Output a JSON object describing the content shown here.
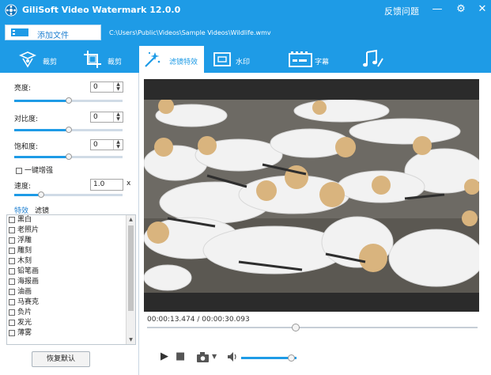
{
  "app": {
    "title": "GiliSoft Video Watermark 12.0.0",
    "feedback_label": "反馈问题"
  },
  "file": {
    "add_label": "添加文件",
    "path": "C:\\Users\\Public\\Videos\\Sample Videos\\Wildlife.wmv"
  },
  "tabs": [
    {
      "label": "裁剪",
      "icon": "crop-tool-icon"
    },
    {
      "label": "裁剪",
      "icon": "crop-frame-icon"
    },
    {
      "label": "滤镜特效",
      "icon": "filter-effects-icon"
    },
    {
      "label": "水印",
      "icon": "watermark-icon"
    },
    {
      "label": "字幕",
      "icon": "subtitle-icon"
    },
    {
      "label": "",
      "icon": "music-icon"
    }
  ],
  "adjust": {
    "brightness": {
      "label": "亮度:",
      "value": "0",
      "level": 0.5
    },
    "contrast": {
      "label": "对比度:",
      "value": "0",
      "level": 0.5
    },
    "saturation": {
      "label": "饱和度:",
      "value": "0",
      "level": 0.5
    },
    "enhance_label": "一键增强",
    "speed": {
      "label": "速度:",
      "value": "1.0",
      "unit": "x",
      "level": 0.25
    }
  },
  "effect_tabs": [
    "特效",
    "滤镜"
  ],
  "effects": [
    "黑白",
    "老照片",
    "浮雕",
    "雕刻",
    "木刻",
    "铅笔画",
    "海报画",
    "油画",
    "马赛克",
    "负片",
    "发光",
    "薄雾"
  ],
  "reset_label": "恢复默认",
  "player": {
    "time": "00:00:13.474 / 00:00:30.093",
    "progress": 0.45,
    "volume": 0.9
  }
}
